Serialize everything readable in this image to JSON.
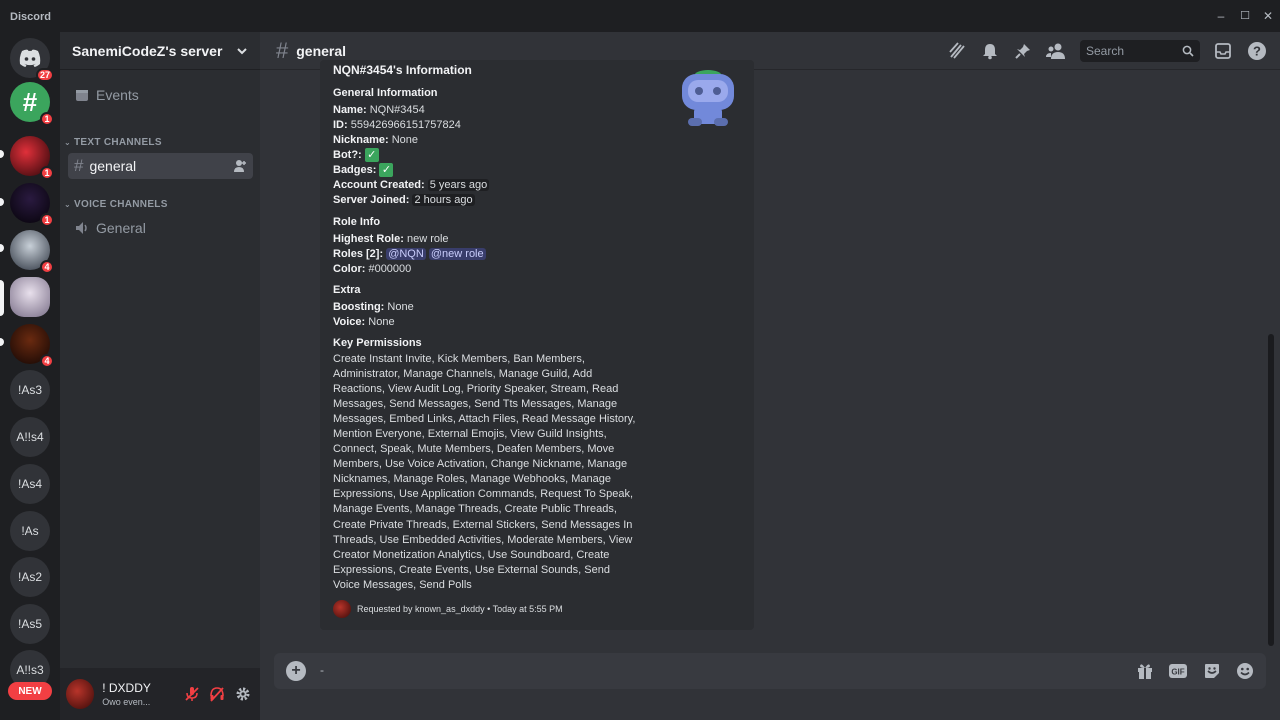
{
  "window": {
    "app_name": "Discord",
    "minimize": "–",
    "maximize": "☐",
    "close": "✕"
  },
  "guilds": {
    "home_badge": "27",
    "items": [
      {
        "badge": "1"
      },
      {
        "badge": "1"
      },
      {
        "badge": "1"
      },
      {
        "badge": "4"
      },
      {
        "badge": ""
      },
      {
        "badge": "4"
      }
    ],
    "text_items": [
      "!As3",
      "A!!s4",
      "!As4",
      "!As",
      "!As2",
      "!As5",
      "A!!s3"
    ],
    "new_label": "NEW"
  },
  "server": {
    "name": "SanemiCodeZ's server",
    "events_label": "Events",
    "text_category": "TEXT CHANNELS",
    "voice_category": "VOICE CHANNELS",
    "text_channel": "general",
    "voice_channel": "General"
  },
  "user": {
    "name": "! DXDDY",
    "status": "Owo even..."
  },
  "header": {
    "channel": "general",
    "search_placeholder": "Search"
  },
  "embed": {
    "title": "NQN#3454's Information",
    "general_heading": "General Information",
    "name_label": "Name:",
    "name_value": "NQN#3454",
    "id_label": "ID:",
    "id_value": "559426966151757824",
    "nickname_label": "Nickname:",
    "nickname_value": "None",
    "bot_label": "Bot?:",
    "bot_value": "✓",
    "badges_label": "Badges:",
    "badges_value": "✓",
    "created_label": "Account Created:",
    "created_value": "5 years ago",
    "joined_label": "Server Joined:",
    "joined_value": "2 hours ago",
    "role_heading": "Role Info",
    "highest_label": "Highest Role:",
    "highest_value": "new role",
    "roles_label": "Roles [2]:",
    "role1": "@NQN",
    "role2": "@new role",
    "color_label": "Color:",
    "color_value": "#000000",
    "extra_heading": "Extra",
    "boosting_label": "Boosting:",
    "boosting_value": "None",
    "voice_label": "Voice:",
    "voice_value": "None",
    "perm_heading": "Key Permissions",
    "permissions": "Create Instant Invite, Kick Members, Ban Members, Administrator, Manage Channels, Manage Guild, Add Reactions, View Audit Log, Priority Speaker, Stream, Read Messages, Send Messages, Send Tts Messages, Manage Messages, Embed Links, Attach Files, Read Message History, Mention Everyone, External Emojis, View Guild Insights, Connect, Speak, Mute Members, Deafen Members, Move Members, Use Voice Activation, Change Nickname, Manage Nicknames, Manage Roles, Manage Webhooks, Manage Expressions, Use Application Commands, Request To Speak, Manage Events, Manage Threads, Create Public Threads, Create Private Threads, External Stickers, Send Messages In Threads, Use Embedded Activities, Moderate Members, View Creator Monetization Analytics, Use Soundboard, Create Expressions, Create Events, Use External Sounds, Send Voice Messages, Send Polls",
    "footer": "Requested by known_as_dxddy • Today at 5:55 PM"
  },
  "composer": {
    "cursor": "-"
  },
  "colors": {
    "accent": "#5865f2",
    "danger": "#f23f43",
    "bg": "#313338",
    "sidebar": "#2b2d31",
    "rail": "#1e1f22"
  }
}
